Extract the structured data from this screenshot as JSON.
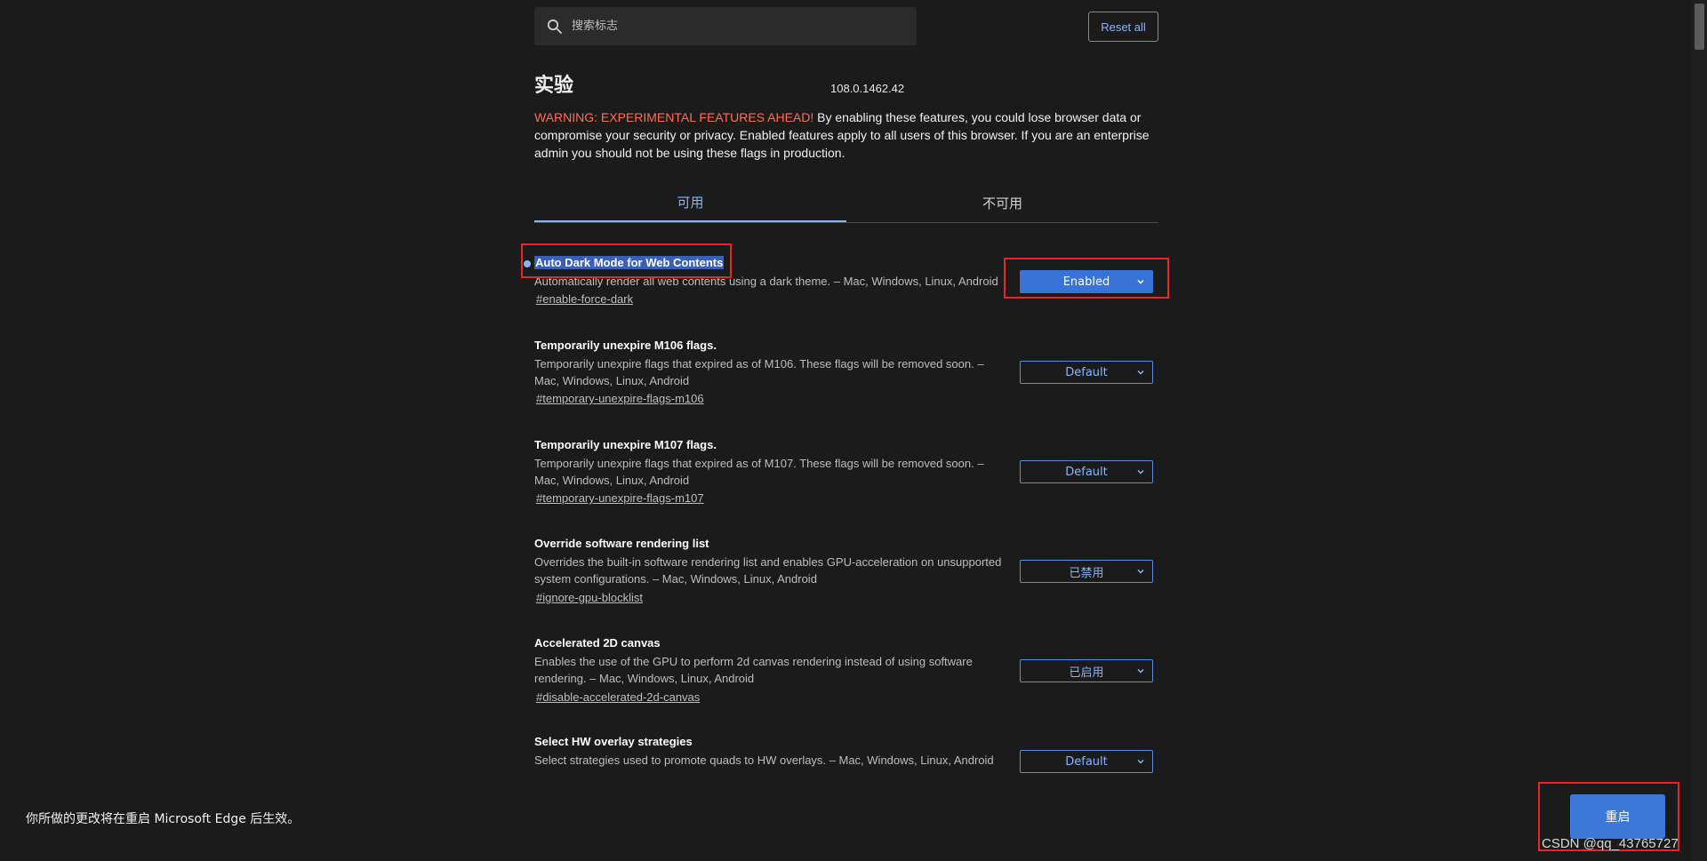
{
  "search": {
    "placeholder": "搜索标志"
  },
  "header": {
    "reset_label": "Reset all",
    "title": "实验",
    "version": "108.0.1462.42"
  },
  "warning": {
    "label": "WARNING: EXPERIMENTAL FEATURES AHEAD!",
    "text": " By enabling these features, you could lose browser data or compromise your security or privacy. Enabled features apply to all users of this browser. If you are an enterprise admin you should not be using these flags in production."
  },
  "tabs": [
    {
      "label": "可用",
      "active": true
    },
    {
      "label": "不可用",
      "active": false
    }
  ],
  "flags": [
    {
      "title": "Auto Dark Mode for Web Contents",
      "desc": "Automatically render all web contents using a dark theme. – Mac, Windows, Linux, Android",
      "link": "#enable-force-dark",
      "value": "Enabled"
    },
    {
      "title": "Temporarily unexpire M106 flags.",
      "desc": "Temporarily unexpire flags that expired as of M106. These flags will be removed soon. – Mac, Windows, Linux, Android",
      "link": "#temporary-unexpire-flags-m106",
      "value": "Default"
    },
    {
      "title": "Temporarily unexpire M107 flags.",
      "desc": "Temporarily unexpire flags that expired as of M107. These flags will be removed soon. – Mac, Windows, Linux, Android",
      "link": "#temporary-unexpire-flags-m107",
      "value": "Default"
    },
    {
      "title": "Override software rendering list",
      "desc": "Overrides the built-in software rendering list and enables GPU-acceleration on unsupported system configurations. – Mac, Windows, Linux, Android",
      "link": "#ignore-gpu-blocklist",
      "value": "已禁用"
    },
    {
      "title": "Accelerated 2D canvas",
      "desc": "Enables the use of the GPU to perform 2d canvas rendering instead of using software rendering. – Mac, Windows, Linux, Android",
      "link": "#disable-accelerated-2d-canvas",
      "value": "已启用"
    },
    {
      "title": "Select HW overlay strategies",
      "desc": "Select strategies used to promote quads to HW overlays. – Mac, Windows, Linux, Android",
      "link": "",
      "value": "Default"
    }
  ],
  "footer": {
    "message": "你所做的更改将在重启 Microsoft Edge 后生效。",
    "relaunch_label": "重启"
  },
  "watermark": "CSDN @qq_43765727",
  "colors": {
    "accent": "#8ab4f8",
    "warning": "#ff6e55",
    "button": "#3b78d8",
    "annotation": "#e8262a"
  }
}
